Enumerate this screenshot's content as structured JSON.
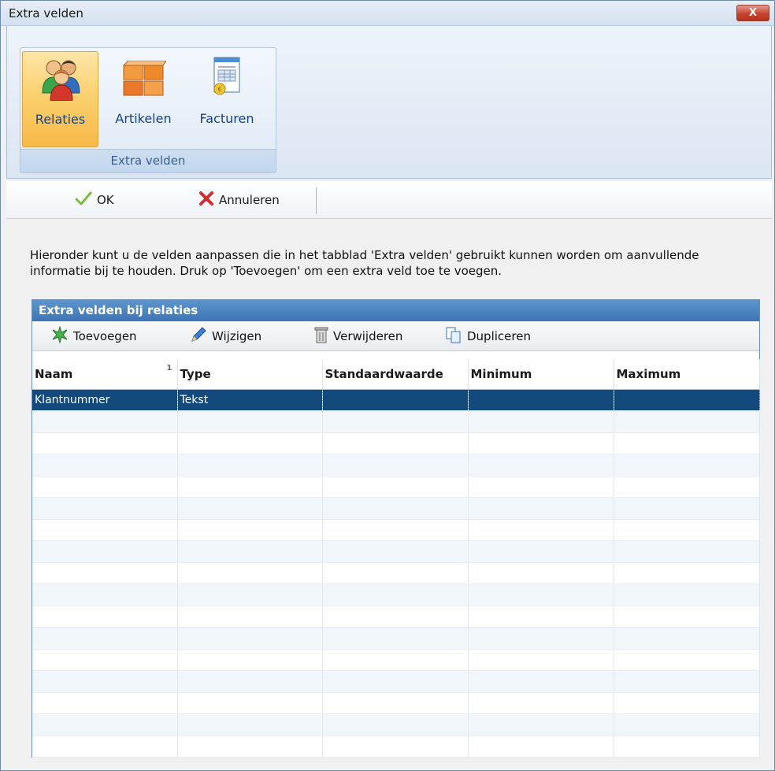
{
  "window": {
    "title": "Extra velden",
    "close_label": "X"
  },
  "ribbon": {
    "buttons": [
      {
        "label": "Relaties",
        "icon": "users-icon"
      },
      {
        "label": "Artikelen",
        "icon": "boxes-icon"
      },
      {
        "label": "Facturen",
        "icon": "invoice-icon"
      }
    ],
    "group_caption": "Extra velden",
    "active": "Relaties"
  },
  "toolbar": {
    "ok_label": "OK",
    "cancel_label": "Annuleren"
  },
  "description": "Hieronder kunt u de velden aanpassen die in het tabblad 'Extra velden' gebruikt kunnen worden om aanvullende informatie bij te houden. Druk op 'Toevoegen' om een extra veld toe te voegen.",
  "panel": {
    "title": "Extra velden bij relaties",
    "actions": {
      "add": "Toevoegen",
      "edit": "Wijzigen",
      "delete": "Verwijderen",
      "duplicate": "Dupliceren"
    },
    "columns": [
      "Naam",
      "Type",
      "Standaardwaarde",
      "Minimum",
      "Maximum"
    ],
    "sort_indicator": "1",
    "rows": [
      [
        "Klantnummer",
        "Tekst",
        "",
        "",
        ""
      ]
    ]
  },
  "colors": {
    "selection": "#124a7e",
    "panel_header": "#4a84c0",
    "ribbon_active": "#fbd16f"
  }
}
